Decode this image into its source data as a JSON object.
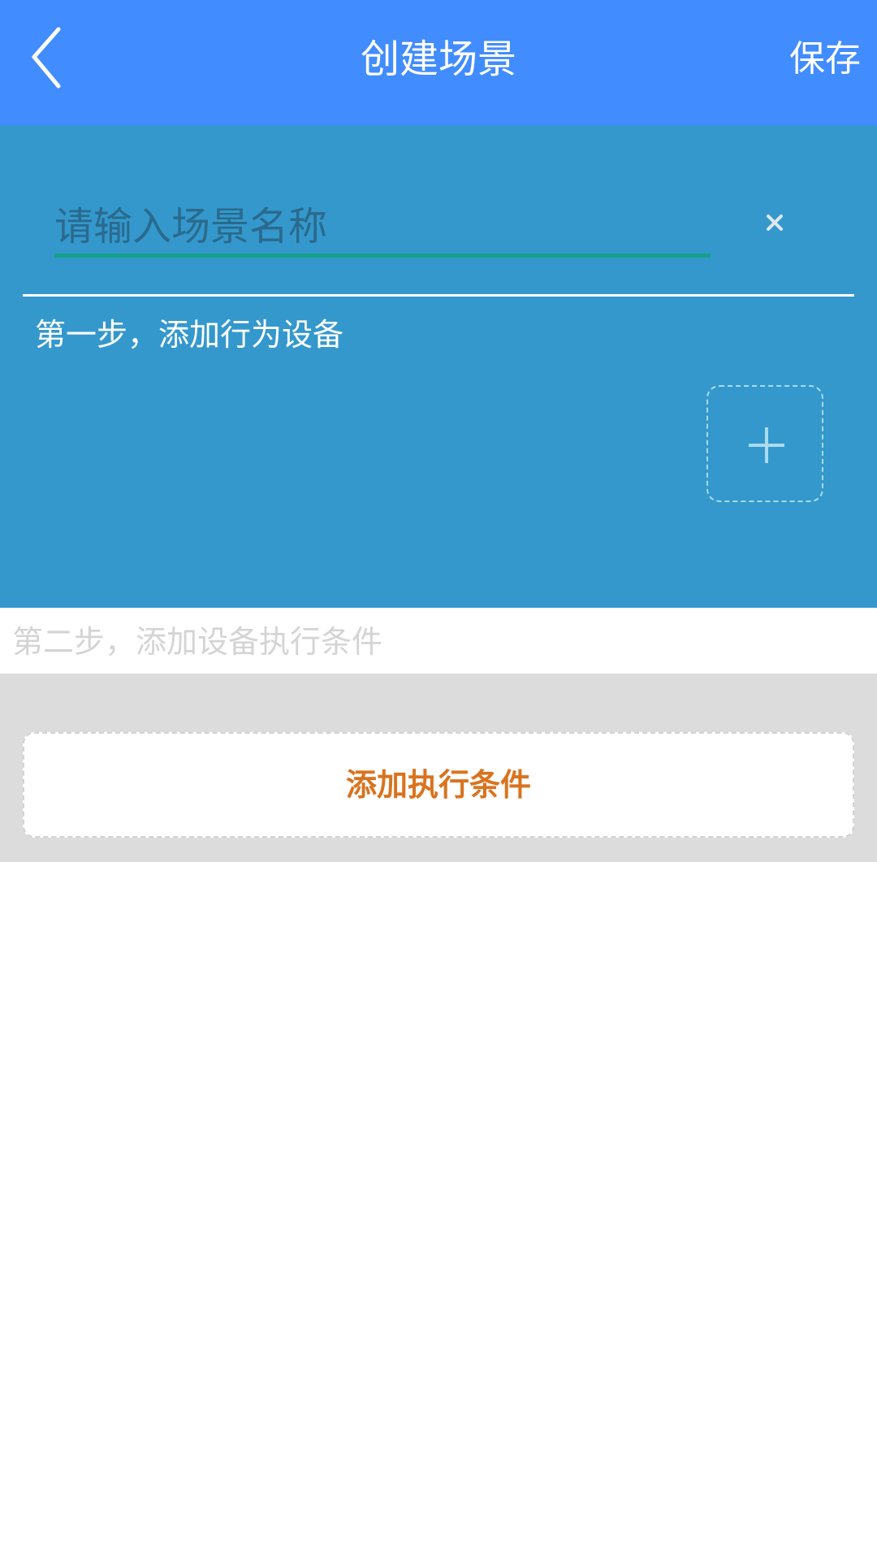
{
  "header": {
    "back_icon": "chevron-left-icon",
    "title": "创建场景",
    "save_label": "保存"
  },
  "step1": {
    "name_input": {
      "value": "",
      "placeholder": "请输入场景名称"
    },
    "clear_icon": "close-icon",
    "label": "第一步，添加行为设备",
    "add_icon": "plus-icon"
  },
  "step2": {
    "label": "第二步，添加设备执行条件",
    "add_condition_label": "添加执行条件"
  },
  "colors": {
    "header": "#418cfe",
    "step1_panel": "#3498cd",
    "input_underline": "#14a08a",
    "condition_panel": "#dcdcdc",
    "accent_text": "#d9731f"
  }
}
